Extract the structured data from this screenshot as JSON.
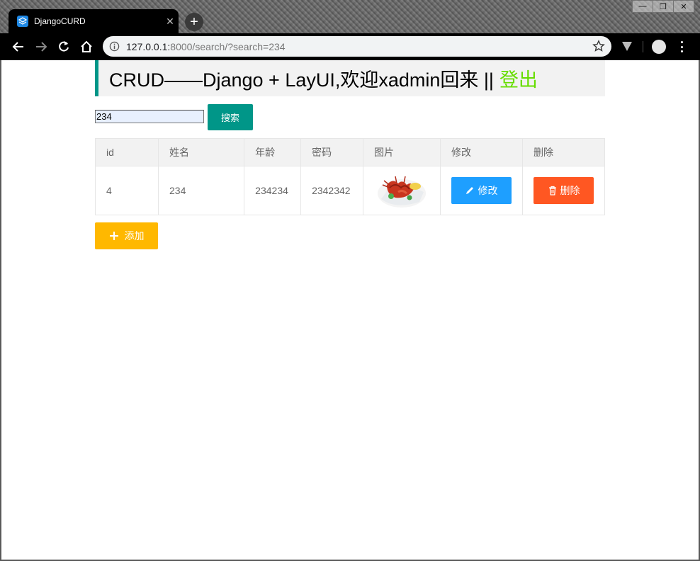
{
  "browser": {
    "tab_title": "DjangoCURD",
    "url_host": "127.0.0.1:",
    "url_rest": "8000/search/?search=234",
    "window_buttons": [
      "—",
      "❐",
      "✕"
    ]
  },
  "page": {
    "banner_text": "CRUD——Django + LayUI,欢迎xadmin回来 ||",
    "logout_label": "登出",
    "search_value": "234",
    "search_button": "搜索",
    "add_button": "添加",
    "table": {
      "headers": [
        "id",
        "姓名",
        "年龄",
        "密码",
        "图片",
        "修改",
        "删除"
      ],
      "rows": [
        {
          "id": "4",
          "name": "234",
          "age": "234234",
          "password": "2342342",
          "edit_label": "修改",
          "delete_label": "删除"
        }
      ]
    }
  },
  "colors": {
    "accent_teal": "#009688",
    "edit_blue": "#1e9fff",
    "delete_orange": "#ff5722",
    "add_yellow": "#ffb800",
    "logout_green": "#66dd00"
  }
}
